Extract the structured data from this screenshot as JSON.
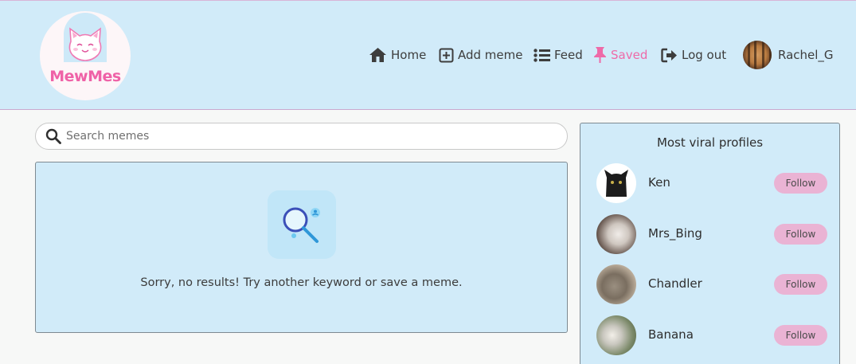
{
  "app": {
    "logo_text": "MewMes"
  },
  "nav": {
    "home": "Home",
    "add_meme": "Add meme",
    "feed": "Feed",
    "saved": "Saved",
    "logout": "Log out",
    "username": "Rachel_G",
    "active_item": "saved"
  },
  "search": {
    "placeholder": "Search memes",
    "value": ""
  },
  "results": {
    "empty_message": "Sorry, no results! Try another keyword or save a meme."
  },
  "sidebar": {
    "title": "Most viral profiles",
    "profiles": [
      {
        "name": "Ken",
        "follow_label": "Follow"
      },
      {
        "name": "Mrs_Bing",
        "follow_label": "Follow"
      },
      {
        "name": "Chandler",
        "follow_label": "Follow"
      },
      {
        "name": "Banana",
        "follow_label": "Follow"
      }
    ]
  },
  "colors": {
    "header_bg": "#d1ebf9",
    "accent_pink": "#ee6aa8",
    "follow_bg": "#eab3d4",
    "page_bg": "#f7f8f7"
  },
  "icons": {
    "home": "home-icon",
    "add": "plus-square-icon",
    "feed": "list-icon",
    "saved": "pin-icon",
    "logout": "logout-icon",
    "search": "search-icon"
  }
}
